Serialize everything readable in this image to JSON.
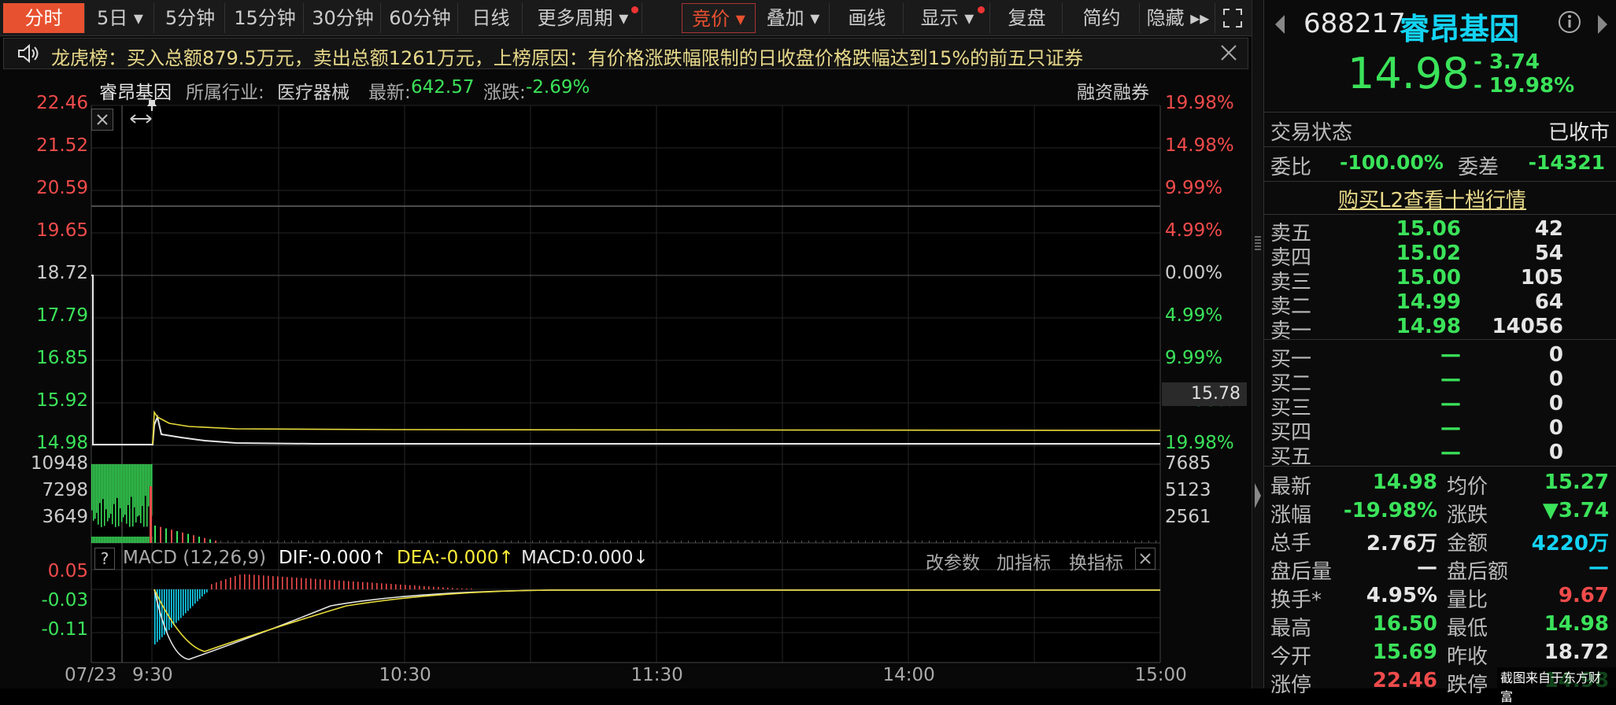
{
  "toolbar": {
    "items": [
      {
        "label": "分时",
        "state": "selected"
      },
      {
        "label": "5日 ▾"
      },
      {
        "label": "5分钟"
      },
      {
        "label": "15分钟"
      },
      {
        "label": "30分钟"
      },
      {
        "label": "60分钟"
      },
      {
        "label": "日线"
      },
      {
        "label": "更多周期 ▾"
      },
      {
        "label": "竞价 ▾",
        "state": "active"
      },
      {
        "label": "叠加 ▾"
      },
      {
        "label": "画线"
      },
      {
        "label": "显示 ▾"
      },
      {
        "label": "复盘"
      },
      {
        "label": "简约"
      },
      {
        "label": "隐藏 ▸▸"
      }
    ]
  },
  "banner": {
    "text": "龙虎榜：买入总额879.5万元，卖出总额1261万元，上榜原因：有价格涨跌幅限制的日收盘价格跌幅达到15%的前五只证券"
  },
  "info": {
    "name": "睿昂基因",
    "industry_label": "所属行业:",
    "industry": "医疗器械",
    "latest_label": "最新:",
    "latest": "642.57",
    "change_label": "涨跌:",
    "change": "-2.69%",
    "margin": "融资融券"
  },
  "price_chart": {
    "left_labels": [
      {
        "text": "22.46",
        "color": "#f04b4b"
      },
      {
        "text": "21.52",
        "color": "#f04b4b"
      },
      {
        "text": "20.59",
        "color": "#f04b4b"
      },
      {
        "text": "19.65",
        "color": "#f04b4b"
      },
      {
        "text": "18.72",
        "color": "#cccccc"
      },
      {
        "text": "17.79",
        "color": "#3be35a"
      },
      {
        "text": "16.85",
        "color": "#3be35a"
      },
      {
        "text": "15.92",
        "color": "#3be35a"
      },
      {
        "text": "14.98",
        "color": "#3be35a"
      }
    ],
    "right_labels": [
      {
        "text": "19.98%",
        "color": "#f04b4b"
      },
      {
        "text": "14.98%",
        "color": "#f04b4b"
      },
      {
        "text": "9.99%",
        "color": "#f04b4b"
      },
      {
        "text": "4.99%",
        "color": "#f04b4b"
      },
      {
        "text": "0.00%",
        "color": "#cccccc"
      },
      {
        "text": "4.99%",
        "color": "#3be35a"
      },
      {
        "text": "9.99%",
        "color": "#3be35a"
      },
      {
        "text": "14.98%",
        "color": "#3be35a"
      },
      {
        "text": "19.98%",
        "color": "#3be35a"
      }
    ],
    "cursor_value": "15.78"
  },
  "volume_chart": {
    "left_labels": [
      "10948",
      "7298",
      "3649"
    ],
    "right_labels": [
      "7685",
      "5123",
      "2561"
    ]
  },
  "macd": {
    "help": "?",
    "title": "MACD (12,26,9)",
    "dif": "DIF:-0.000↑",
    "dea": "DEA:-0.000↑",
    "macd": "MACD:0.000↓",
    "left_labels": [
      "0.05",
      "-0.03",
      "-0.11"
    ],
    "btn_params": "改参数",
    "btn_add": "加指标",
    "btn_switch": "换指标"
  },
  "time_axis": {
    "labels": [
      "07/23",
      "9:30",
      "10:30",
      "11:30",
      "14:00",
      "15:00"
    ]
  },
  "quote": {
    "code": "688217",
    "name": "睿昂基因",
    "price": "14.98",
    "change": "- 3.74",
    "change_pct": "- 19.98%",
    "trade_status_label": "交易状态",
    "trade_status": "已收市",
    "wb_label": "委比",
    "wb": "-100.00%",
    "wc_label": "委差",
    "wc": "-14321",
    "l2_link": "购买L2查看十档行情",
    "asks": [
      {
        "label": "卖五",
        "price": "15.06",
        "vol": "42"
      },
      {
        "label": "卖四",
        "price": "15.02",
        "vol": "54"
      },
      {
        "label": "卖三",
        "price": "15.00",
        "vol": "105"
      },
      {
        "label": "卖二",
        "price": "14.99",
        "vol": "64"
      },
      {
        "label": "卖一",
        "price": "14.98",
        "vol": "14056"
      }
    ],
    "bids": [
      {
        "label": "买一",
        "price": "—",
        "vol": "0"
      },
      {
        "label": "买二",
        "price": "—",
        "vol": "0"
      },
      {
        "label": "买三",
        "price": "—",
        "vol": "0"
      },
      {
        "label": "买四",
        "price": "—",
        "vol": "0"
      },
      {
        "label": "买五",
        "price": "—",
        "vol": "0"
      }
    ],
    "stats": [
      {
        "l1": "最新",
        "v1": "14.98",
        "c1": "green",
        "l2": "均价",
        "v2": "15.27",
        "c2": "green"
      },
      {
        "l1": "涨幅",
        "v1": "-19.98%",
        "c1": "green",
        "l2": "涨跌",
        "v2": "▼3.74",
        "c2": "green"
      },
      {
        "l1": "总手",
        "v1": "2.76万",
        "c1": "white",
        "l2": "金额",
        "v2": "4220万",
        "c2": "cyan"
      },
      {
        "l1": "盘后量",
        "v1": "—",
        "c1": "white",
        "l2": "盘后额",
        "v2": "—",
        "c2": "cyan"
      },
      {
        "l1": "换手*",
        "v1": "4.95%",
        "c1": "white",
        "l2": "量比",
        "v2": "9.67",
        "c2": "red"
      },
      {
        "l1": "最高",
        "v1": "16.50",
        "c1": "green",
        "l2": "最低",
        "v2": "14.98",
        "c2": "green"
      },
      {
        "l1": "今开",
        "v1": "15.69",
        "c1": "green",
        "l2": "昨收",
        "v2": "18.72",
        "c2": "white"
      },
      {
        "l1": "涨停",
        "v1": "22.46",
        "c1": "red",
        "l2": "跌停",
        "v2": "14.98",
        "c2": "green"
      }
    ],
    "watermark": "截图来自于东方财富"
  }
}
